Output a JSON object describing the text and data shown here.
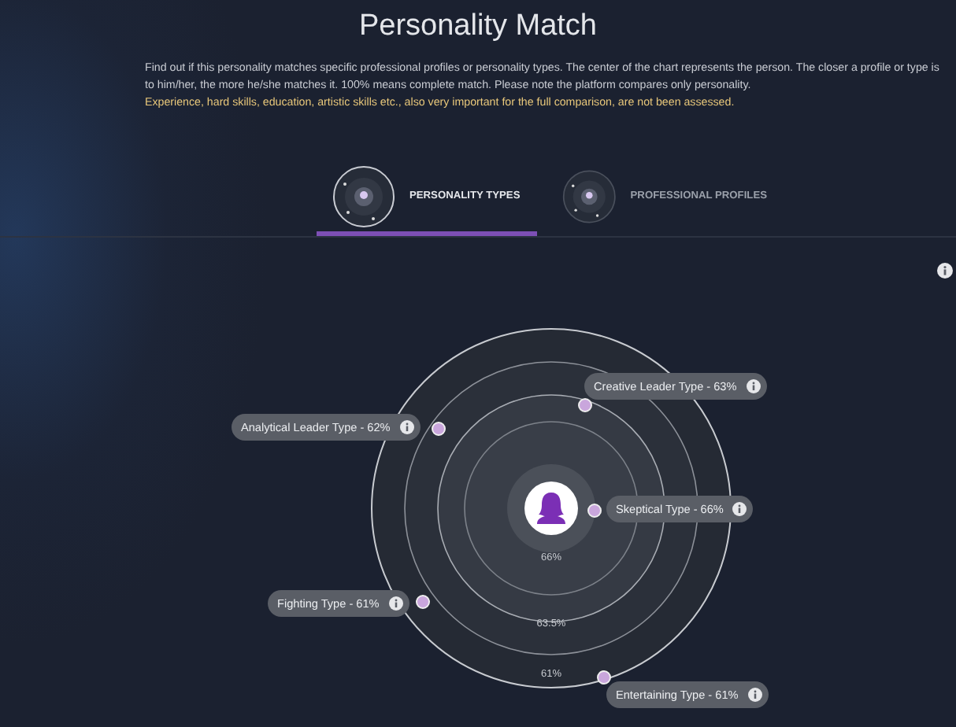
{
  "title": "Personality Match",
  "intro": "Find out if this personality matches specific professional profiles or personality types. The center of the chart represents the person. The closer a profile or type is to him/her, the more he/she matches it. 100% means complete match. Please note the platform compares only personality.",
  "warning": "Experience, hard skills, education, artistic skills etc., also very important for the full comparison, are not been assessed.",
  "tabs": [
    {
      "label": "PERSONALITY TYPES",
      "selected": true
    },
    {
      "label": "PROFESSIONAL PROFILES",
      "selected": false
    }
  ],
  "chart": {
    "ring_labels": [
      "66%",
      "63.5%",
      "61%"
    ],
    "matches": [
      {
        "label": "Creative Leader Type - 63%"
      },
      {
        "label": "Analytical Leader Type - 62%"
      },
      {
        "label": "Skeptical Type - 66%"
      },
      {
        "label": "Fighting Type - 61%"
      },
      {
        "label": "Entertaining Type - 61%"
      }
    ]
  }
}
